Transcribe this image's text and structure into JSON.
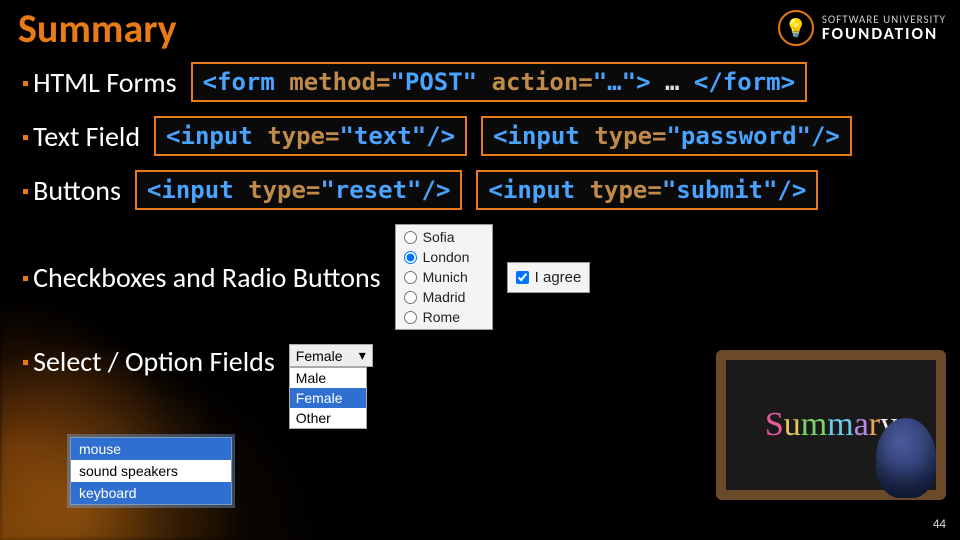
{
  "title": "Summary",
  "logo": {
    "line1": "SOFTWARE UNIVERSITY",
    "line2": "FOUNDATION"
  },
  "bullets": [
    "HTML Forms",
    "Text Field",
    "Buttons",
    "Checkboxes and Radio Buttons",
    "Select / Option Fields"
  ],
  "code": {
    "form": "<form method=\"POST\" action=\"…\"> … </form>",
    "input_text": "<input type=\"text\"/>",
    "input_password": "<input type=\"password\"/>",
    "input_reset": "<input type=\"reset\"/>",
    "input_submit": "<input type=\"submit\"/>"
  },
  "radios": [
    "Sofia",
    "London",
    "Munich",
    "Madrid",
    "Rome"
  ],
  "radio_selected": "London",
  "checkbox_label": "I agree",
  "checkbox_checked": true,
  "dropdown": {
    "selected": "Female",
    "options": [
      "Male",
      "Female",
      "Other"
    ]
  },
  "listbox": [
    "mouse",
    "sound speakers",
    "keyboard"
  ],
  "listbox_selected": [
    "mouse",
    "keyboard"
  ],
  "chalkboard_text": "Summary",
  "page": "44",
  "colors": {
    "accent": "#E87B17",
    "code_border": "#E87B17",
    "code_tag": "#4aa3ff",
    "code_attr": "#c08a4a"
  }
}
